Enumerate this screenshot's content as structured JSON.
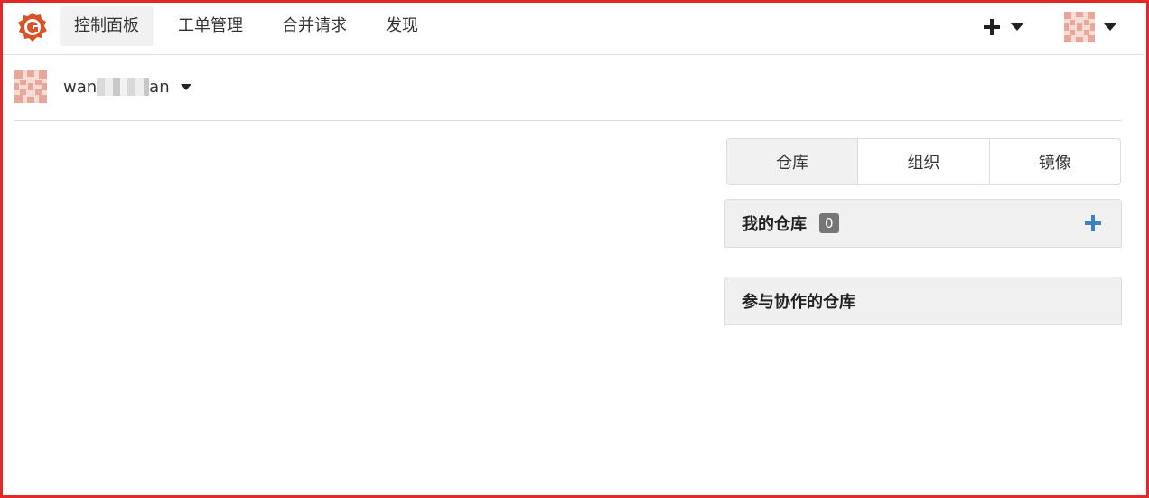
{
  "nav": {
    "items": [
      {
        "label": "控制面板",
        "active": true
      },
      {
        "label": "工单管理",
        "active": false
      },
      {
        "label": "合并请求",
        "active": false
      },
      {
        "label": "发现",
        "active": false
      }
    ],
    "logo_icon": "gitea-logo-icon",
    "create_icon": "plus-icon",
    "menu_caret_icon": "caret-down-icon",
    "brand_color": "#d9532a"
  },
  "header": {
    "username_prefix": "wan",
    "username_suffix": "an"
  },
  "tabs": [
    {
      "label": "仓库",
      "active": true
    },
    {
      "label": "组织",
      "active": false
    },
    {
      "label": "镜像",
      "active": false
    }
  ],
  "panels": {
    "my_repos": {
      "title": "我的仓库",
      "count": "0",
      "add_icon": "plus-icon",
      "add_color": "#3b82c4"
    },
    "collab_repos": {
      "title": "参与协作的仓库"
    }
  },
  "colors": {
    "frame_border": "#e02a2a",
    "avatar": "#e8a79b"
  }
}
